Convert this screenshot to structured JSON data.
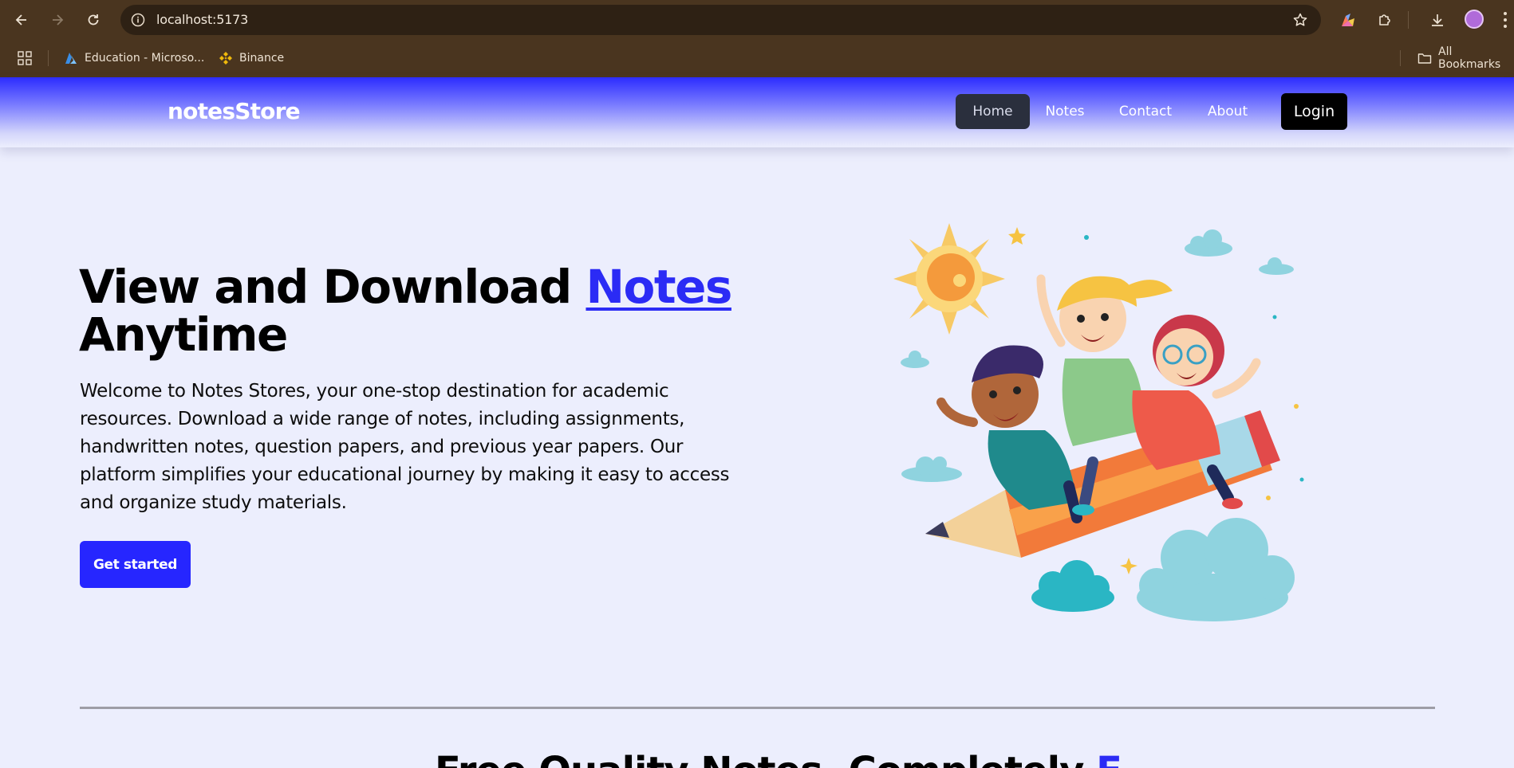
{
  "browser": {
    "url": "localhost:5173",
    "bookmarks": [
      {
        "label": "Education - Microso...",
        "icon": "azure-icon"
      },
      {
        "label": "Binance",
        "icon": "binance-icon"
      }
    ],
    "all_bookmarks_label": "All Bookmarks"
  },
  "navbar": {
    "brand": "notesStore",
    "links": [
      "Home",
      "Notes",
      "Contact",
      "About"
    ],
    "active": "Home",
    "login_label": "Login"
  },
  "hero": {
    "title_part1": "View and Download ",
    "title_accent": "Notes",
    "title_part2": "Anytime",
    "description": "Welcome to Notes Stores, your one-stop destination for academic resources. Download a wide range of notes, including assignments, handwritten notes, question papers, and previous year papers. Our platform simplifies your educational journey by making it easy to access and organize study materials.",
    "cta_label": "Get started",
    "illustration": "kids-riding-pencil-illustration"
  },
  "next_section": {
    "heading_part": "Free Quality Notes, Completely ",
    "heading_accent": "F"
  },
  "colors": {
    "accent": "#2b2bf5",
    "page_bg": "#eceefd",
    "chrome_bg": "#4a351f",
    "login_bg": "#000000"
  }
}
